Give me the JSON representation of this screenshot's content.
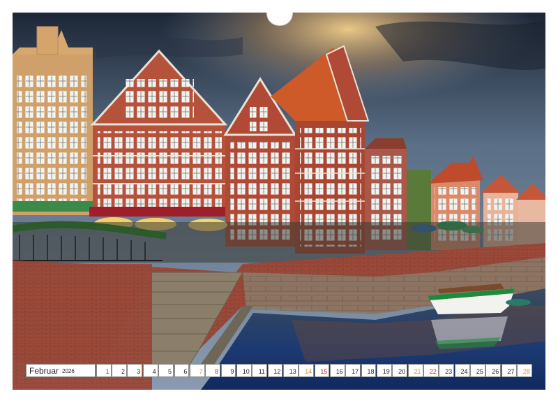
{
  "calendar": {
    "month": "Februar",
    "year": "2026",
    "days": [
      {
        "n": "1",
        "wd": "",
        "type": "sun"
      },
      {
        "n": "2",
        "wd": "",
        "type": "wk"
      },
      {
        "n": "3",
        "wd": "",
        "type": "wk"
      },
      {
        "n": "4",
        "wd": "",
        "type": "wk"
      },
      {
        "n": "5",
        "wd": "",
        "type": "wk"
      },
      {
        "n": "6",
        "wd": "",
        "type": "wk"
      },
      {
        "n": "7",
        "wd": "",
        "type": "sat"
      },
      {
        "n": "8",
        "wd": "",
        "type": "sun"
      },
      {
        "n": "9",
        "wd": "",
        "type": "wk"
      },
      {
        "n": "10",
        "wd": "",
        "type": "wk"
      },
      {
        "n": "11",
        "wd": "",
        "type": "wk"
      },
      {
        "n": "12",
        "wd": "",
        "type": "wk"
      },
      {
        "n": "13",
        "wd": "",
        "type": "wk"
      },
      {
        "n": "14",
        "wd": "",
        "type": "sat"
      },
      {
        "n": "15",
        "wd": "",
        "type": "sun"
      },
      {
        "n": "16",
        "wd": "",
        "type": "wk"
      },
      {
        "n": "17",
        "wd": "",
        "type": "wk"
      },
      {
        "n": "18",
        "wd": "",
        "type": "wk"
      },
      {
        "n": "19",
        "wd": "",
        "type": "wk"
      },
      {
        "n": "20",
        "wd": "",
        "type": "wk"
      },
      {
        "n": "21",
        "wd": "",
        "type": "sat"
      },
      {
        "n": "22",
        "wd": "",
        "type": "sun"
      },
      {
        "n": "23",
        "wd": "",
        "type": "wk"
      },
      {
        "n": "24",
        "wd": "",
        "type": "wk"
      },
      {
        "n": "25",
        "wd": "",
        "type": "wk"
      },
      {
        "n": "26",
        "wd": "",
        "type": "wk"
      },
      {
        "n": "27",
        "wd": "",
        "type": "wk"
      },
      {
        "n": "28",
        "wd": "",
        "type": "sat"
      }
    ]
  },
  "colors": {
    "sky_top": "#1f2a3a",
    "sky_mid": "#5a6f86",
    "sky_glow": "#e8b66a",
    "water": "#1d3a6e",
    "brick": "#b5523c",
    "saturday": "#d98c2a",
    "sunday": "#c22a2a"
  }
}
